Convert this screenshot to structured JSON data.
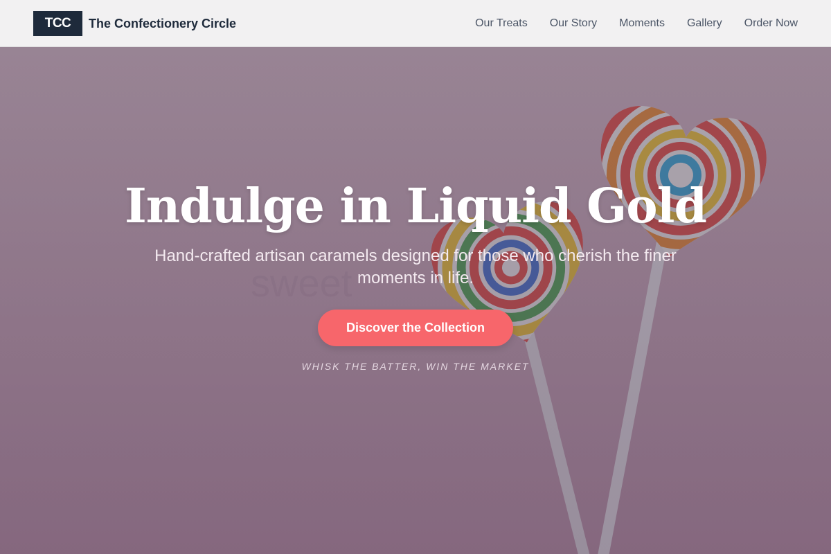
{
  "header": {
    "logo_badge": "TCC",
    "brand_name": "The Confectionery Circle",
    "nav": [
      {
        "label": "Our Treats"
      },
      {
        "label": "Our Story"
      },
      {
        "label": "Moments"
      },
      {
        "label": "Gallery"
      },
      {
        "label": "Order Now"
      }
    ]
  },
  "hero": {
    "title": "Indulge in Liquid Gold",
    "subtitle": "Hand-crafted artisan caramels designed for those who cherish the finer moments in life.",
    "cta_label": "Discover the Collection",
    "tagline": "WHISK THE BATTER, WIN THE MARKET",
    "background_text": "sweet",
    "image_description_icon": "heart-lollipops-image"
  },
  "colors": {
    "header_bg": "#f2f1f2",
    "logo_badge_bg": "#1e2a3b",
    "nav_text": "#4b5566",
    "cta_bg": "#f7666b",
    "hero_bg": "#c9a4b5"
  }
}
